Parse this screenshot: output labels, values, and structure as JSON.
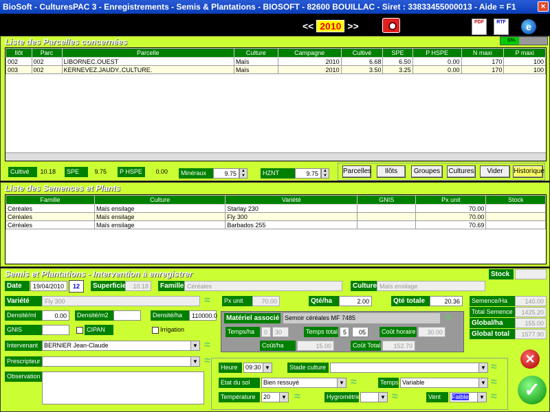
{
  "window": {
    "title": "BioSoft - CulturesPAC 3 - Enregistrements - Semis & Plantations   - BIOSOFT - 82600 BOUILLAC - Siret : 33833455000013 - Aide = F1"
  },
  "year_nav": {
    "prev": "<<",
    "year": "2010",
    "next": ">>"
  },
  "toolbar": {
    "pdf": "PDF",
    "rtf": "RTF",
    "ie": "e",
    "progress_label": "6%"
  },
  "parcelles": {
    "title": "Liste des Parcelles concernées",
    "headers": [
      "Ilôt",
      "Parc",
      "Parcelle",
      "Culture",
      "Campagne",
      "Cultivé",
      "SPE",
      "P HSPE",
      "N maxi",
      "P maxi"
    ],
    "rows": [
      [
        "002",
        "002",
        "LIBORNEC.OUEST",
        "Maïs",
        "2010",
        "6.68",
        "6.50",
        "0.00",
        "170",
        "100"
      ],
      [
        "003",
        "002",
        "KERNEVEZ.JAUDY..CULTURE.",
        "Maïs",
        "2010",
        "3.50",
        "3.25",
        "0.00",
        "170",
        "100"
      ]
    ],
    "totals": {
      "cultive_label": "Cultivé",
      "cultive": "10.18",
      "spe_label": "SPE",
      "spe": "9.75",
      "phspe_label": "P HSPE",
      "phspe": "0.00",
      "mineraux_label": "Minéraux",
      "mineraux": "9.75",
      "hznt_label": "HZNT",
      "hznt": "9.75"
    },
    "buttons": [
      "Parcelles",
      "Ilôts",
      "Groupes",
      "Cultures",
      "Vider",
      "Historique"
    ]
  },
  "semences": {
    "title": "Liste des Semences et Plants",
    "headers": [
      "Famille",
      "Culture",
      "Variété",
      "GNIS",
      "Px unit",
      "Stock"
    ],
    "rows": [
      [
        "Céréales",
        "Maïs ensilage",
        "Starlay 230",
        "",
        "70.00",
        ""
      ],
      [
        "Céréales",
        "Maïs ensilage",
        "Fly 300",
        "",
        "70.00",
        ""
      ],
      [
        "Céréales",
        "Maïs ensilage",
        "Barbados 255",
        "",
        "70.69",
        ""
      ]
    ]
  },
  "intervention": {
    "title": "Semis et Plantations - Intervention à enregistrer",
    "stock_label": "Stock",
    "date_label": "Date",
    "date": "19/04/2010",
    "superficie_label": "Superficie",
    "superficie": "10.18",
    "famille_label": "Famille",
    "famille": "Céréales",
    "culture_label": "Culture",
    "culture": "Maïs ensilage",
    "variete_label": "Variété",
    "variete": "Fly 300",
    "pxunit_label": "Px unit",
    "pxunit": "70.00",
    "qteha_label": "Qté/ha",
    "qteha": "2.00",
    "qtetotale_label": "Qté totale",
    "qtetotale": "20.36",
    "semha_label": "Semence/Ha",
    "semha": "140.00",
    "totalsem_label": "Total Semence",
    "totalsem": "1425.20",
    "globalha_label": "Global/ha",
    "globalha": "155.00",
    "globaltotal_label": "Global total",
    "globaltotal": "1577.90",
    "densml_label": "Densité/ml",
    "densml": "0.00",
    "densm2_label": "Densité/m2",
    "densm2": "",
    "densha_label": "Densité/ha",
    "densha": "110000.0",
    "gnis_label": "GNIS",
    "gnis": "",
    "cipan_label": "CIPAN",
    "irrigation_label": "Irrigation",
    "intervenant_label": "Intervenant",
    "intervenant": "BERNIER Jean-Claude",
    "prescripteur_label": "Prescripteur",
    "prescripteur": "",
    "observation_label": "Observation",
    "materiel": {
      "title": "Matériel associé",
      "name": "Semoir céréales MF 7485",
      "temps_ha_label": "Temps/ha",
      "temps_ha_h": "0",
      "temps_ha_m": "30",
      "temps_total_label": "Temps total",
      "temps_total_h": "5",
      "temps_total_m": "05",
      "cout_horaire_label": "Coût horaire",
      "cout_horaire": "30.00",
      "cout_ha_label": "Coût/ha",
      "cout_ha": "15.00",
      "cout_total_label": "Coût Total",
      "cout_total": "152.70"
    },
    "heure_label": "Heure",
    "heure": "09:30",
    "stade_label": "Stade culture",
    "stade": "",
    "etat_label": "Etat du sol",
    "etat": "Bien ressuyé",
    "temps_label": "Temps",
    "temps": "Variable",
    "temperature_label": "Température",
    "temperature": "20",
    "hygro_label": "Hygrométrie",
    "hygro": "",
    "vent_label": "Vent",
    "vent": "Faible"
  }
}
